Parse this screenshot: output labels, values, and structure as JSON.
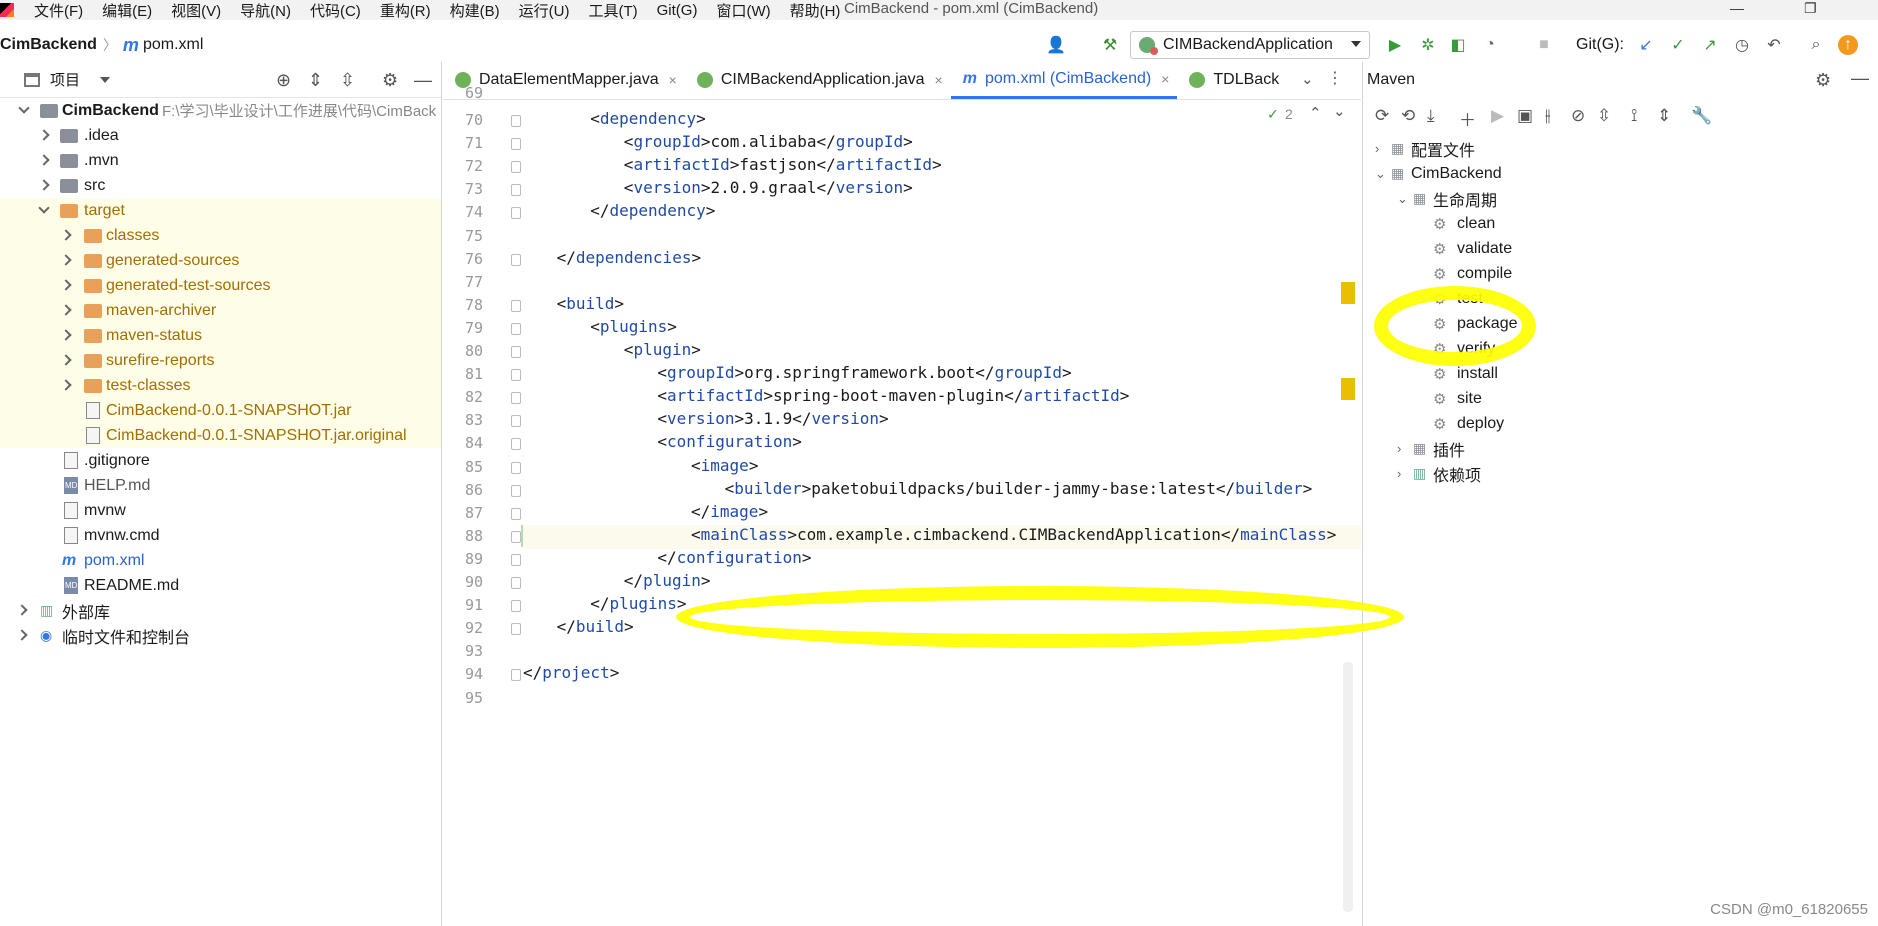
{
  "window": {
    "title": "CimBackend - pom.xml (CimBackend)",
    "menu": [
      "文件(F)",
      "编辑(E)",
      "视图(V)",
      "导航(N)",
      "代码(C)",
      "重构(R)",
      "构建(B)",
      "运行(U)",
      "工具(T)",
      "Git(G)",
      "窗口(W)",
      "帮助(H)"
    ],
    "controls": [
      "—",
      "❐"
    ]
  },
  "navbar": {
    "project": "CimBackend",
    "file": "pom.xml",
    "file_icon": "m",
    "run_config": "CIMBackendApplication",
    "git_label": "Git(G):"
  },
  "project_panel": {
    "title": "项目",
    "root": {
      "name": "CimBackend",
      "path": "F:\\学习\\毕业设计\\工作进展\\代码\\CimBack"
    },
    "items": [
      {
        "label": ".idea"
      },
      {
        "label": ".mvn"
      },
      {
        "label": "src"
      },
      {
        "label": "target"
      },
      {
        "label": "classes"
      },
      {
        "label": "generated-sources"
      },
      {
        "label": "generated-test-sources"
      },
      {
        "label": "maven-archiver"
      },
      {
        "label": "maven-status"
      },
      {
        "label": "surefire-reports"
      },
      {
        "label": "test-classes"
      },
      {
        "label": "CimBackend-0.0.1-SNAPSHOT.jar"
      },
      {
        "label": "CimBackend-0.0.1-SNAPSHOT.jar.original"
      },
      {
        "label": ".gitignore"
      },
      {
        "label": "HELP.md"
      },
      {
        "label": "mvnw"
      },
      {
        "label": "mvnw.cmd"
      },
      {
        "label": "pom.xml"
      },
      {
        "label": "README.md"
      },
      {
        "label": "外部库"
      },
      {
        "label": "临时文件和控制台"
      }
    ],
    "md_badge": "MD"
  },
  "editor": {
    "tabs": [
      {
        "label": "DataElementMapper.java",
        "close": "×"
      },
      {
        "label": "CIMBackendApplication.java",
        "close": "×"
      },
      {
        "label": "pom.xml (CimBackend)",
        "close": "×"
      },
      {
        "label": "TDLBack",
        "close": ""
      }
    ],
    "inspection_count": "2",
    "first_line_number": "69",
    "lines": [
      {
        "n": "70",
        "indent": 2,
        "parts": [
          [
            "<",
            "b"
          ],
          [
            "dependency",
            "t"
          ],
          [
            ">",
            "b"
          ]
        ]
      },
      {
        "n": "71",
        "indent": 3,
        "parts": [
          [
            "<",
            "b"
          ],
          [
            "groupId",
            "t"
          ],
          [
            ">com.alibaba</",
            "b"
          ],
          [
            "groupId",
            "t"
          ],
          [
            ">",
            "b"
          ]
        ]
      },
      {
        "n": "72",
        "indent": 3,
        "parts": [
          [
            "<",
            "b"
          ],
          [
            "artifactId",
            "t"
          ],
          [
            ">fastjson</",
            "b"
          ],
          [
            "artifactId",
            "t"
          ],
          [
            ">",
            "b"
          ]
        ]
      },
      {
        "n": "73",
        "indent": 3,
        "parts": [
          [
            "<",
            "b"
          ],
          [
            "version",
            "t"
          ],
          [
            ">2.0.9.graal</",
            "b"
          ],
          [
            "version",
            "t"
          ],
          [
            ">",
            "b"
          ]
        ]
      },
      {
        "n": "74",
        "indent": 2,
        "parts": [
          [
            "</",
            "b"
          ],
          [
            "dependency",
            "t"
          ],
          [
            ">",
            "b"
          ]
        ]
      },
      {
        "n": "75",
        "indent": 0,
        "parts": []
      },
      {
        "n": "76",
        "indent": 1,
        "parts": [
          [
            "</",
            "b"
          ],
          [
            "dependencies",
            "t"
          ],
          [
            ">",
            "b"
          ]
        ]
      },
      {
        "n": "77",
        "indent": 0,
        "parts": []
      },
      {
        "n": "78",
        "indent": 1,
        "parts": [
          [
            "<",
            "b"
          ],
          [
            "build",
            "t"
          ],
          [
            ">",
            "b"
          ]
        ]
      },
      {
        "n": "79",
        "indent": 2,
        "parts": [
          [
            "<",
            "b"
          ],
          [
            "plugins",
            "t"
          ],
          [
            ">",
            "b"
          ]
        ]
      },
      {
        "n": "80",
        "indent": 3,
        "parts": [
          [
            "<",
            "b"
          ],
          [
            "plugin",
            "t"
          ],
          [
            ">",
            "b"
          ]
        ]
      },
      {
        "n": "81",
        "indent": 4,
        "parts": [
          [
            "<",
            "b"
          ],
          [
            "groupId",
            "t"
          ],
          [
            ">org.springframework.boot</",
            "b"
          ],
          [
            "groupId",
            "t"
          ],
          [
            ">",
            "b"
          ]
        ]
      },
      {
        "n": "82",
        "indent": 4,
        "parts": [
          [
            "<",
            "b"
          ],
          [
            "artifactId",
            "t"
          ],
          [
            ">spring-boot-maven-plugin</",
            "b"
          ],
          [
            "artifactId",
            "t"
          ],
          [
            ">",
            "b"
          ]
        ]
      },
      {
        "n": "83",
        "indent": 4,
        "parts": [
          [
            "<",
            "b"
          ],
          [
            "version",
            "t"
          ],
          [
            ">3.1.9</",
            "b"
          ],
          [
            "version",
            "t"
          ],
          [
            ">",
            "b"
          ]
        ]
      },
      {
        "n": "84",
        "indent": 4,
        "parts": [
          [
            "<",
            "b"
          ],
          [
            "configuration",
            "t"
          ],
          [
            ">",
            "b"
          ]
        ]
      },
      {
        "n": "85",
        "indent": 5,
        "parts": [
          [
            "<",
            "b"
          ],
          [
            "image",
            "t"
          ],
          [
            ">",
            "b"
          ]
        ]
      },
      {
        "n": "86",
        "indent": 6,
        "parts": [
          [
            "<",
            "b"
          ],
          [
            "builder",
            "t"
          ],
          [
            ">paketobuildpacks/builder-jammy-base:latest</",
            "b"
          ],
          [
            "builder",
            "t"
          ],
          [
            ">",
            "b"
          ]
        ]
      },
      {
        "n": "87",
        "indent": 5,
        "parts": [
          [
            "</",
            "b"
          ],
          [
            "image",
            "t"
          ],
          [
            ">",
            "b"
          ]
        ]
      },
      {
        "n": "88",
        "indent": 5,
        "parts": [
          [
            "<",
            "b"
          ],
          [
            "mainClass",
            "t"
          ],
          [
            ">com.example.cimbackend.CIMBackendApplication</",
            "b"
          ],
          [
            "mainClass",
            "t"
          ],
          [
            ">",
            "b"
          ]
        ]
      },
      {
        "n": "89",
        "indent": 4,
        "parts": [
          [
            "</",
            "b"
          ],
          [
            "configuration",
            "t"
          ],
          [
            ">",
            "b"
          ]
        ]
      },
      {
        "n": "90",
        "indent": 3,
        "parts": [
          [
            "</",
            "b"
          ],
          [
            "plugin",
            "t"
          ],
          [
            ">",
            "b"
          ]
        ]
      },
      {
        "n": "91",
        "indent": 2,
        "parts": [
          [
            "</",
            "b"
          ],
          [
            "plugins",
            "t"
          ],
          [
            ">",
            "b"
          ]
        ]
      },
      {
        "n": "92",
        "indent": 1,
        "parts": [
          [
            "</",
            "b"
          ],
          [
            "build",
            "t"
          ],
          [
            ">",
            "b"
          ]
        ]
      },
      {
        "n": "93",
        "indent": 0,
        "parts": []
      },
      {
        "n": "94",
        "indent": 0,
        "parts": [
          [
            "</",
            "b"
          ],
          [
            "project",
            "t"
          ],
          [
            ">",
            "b"
          ]
        ]
      },
      {
        "n": "95",
        "indent": 0,
        "parts": []
      }
    ]
  },
  "maven_panel": {
    "title": "Maven",
    "profiles": "配置文件",
    "project": "CimBackend",
    "lifecycle": "生命周期",
    "phases": [
      "clean",
      "validate",
      "compile",
      "test",
      "package",
      "verify",
      "install",
      "site",
      "deploy"
    ],
    "plugins": "插件",
    "dependencies": "依赖项"
  },
  "colors": {
    "accent": "#3574f0",
    "highlight": "#ffff00",
    "tag": "#1f4aa8"
  },
  "watermark": "CSDN @m0_61820655"
}
